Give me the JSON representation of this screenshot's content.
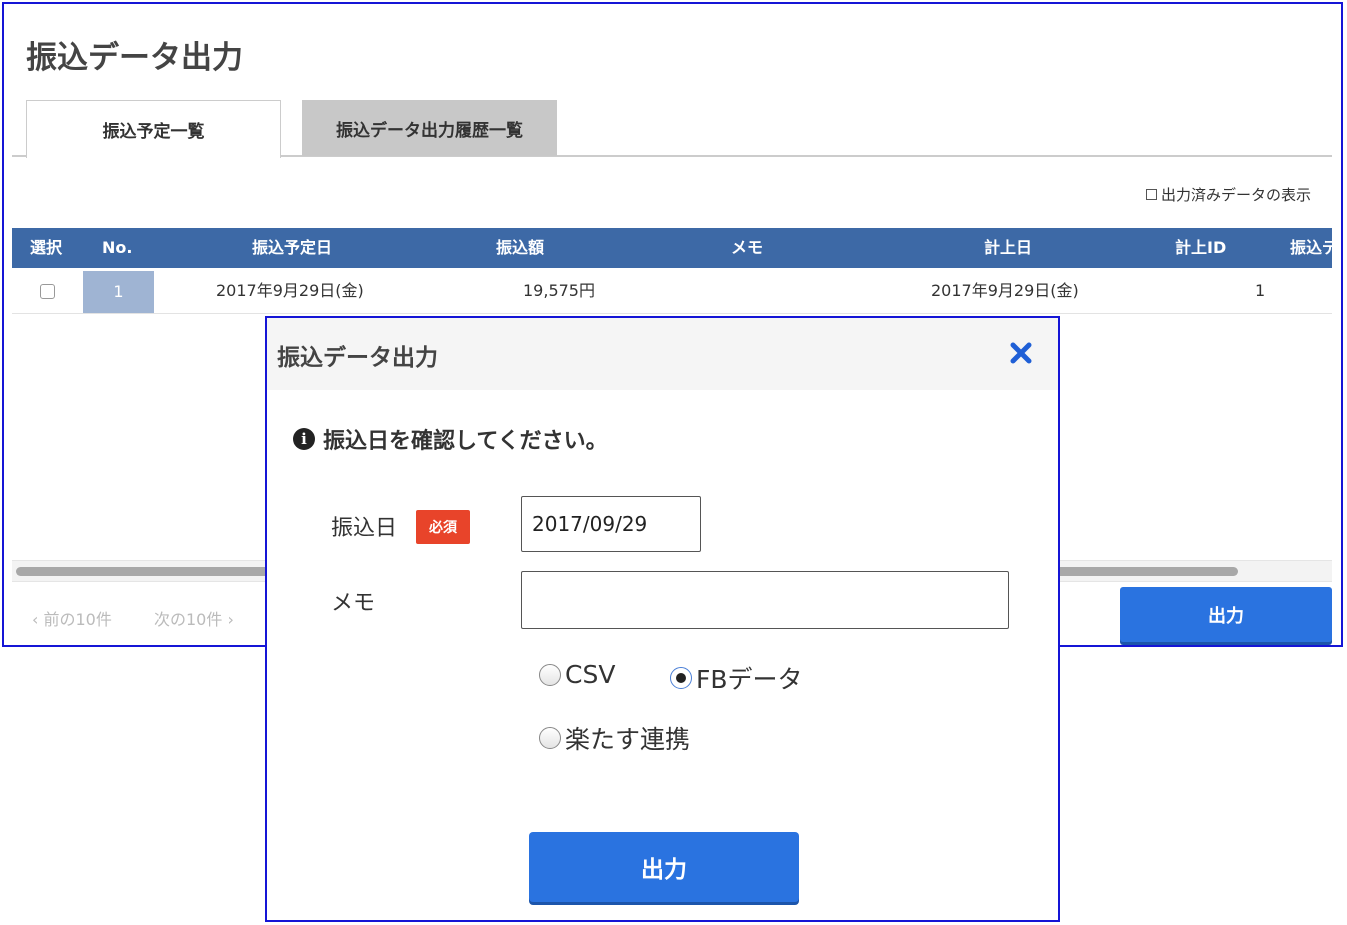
{
  "page": {
    "title": "振込データ出力",
    "tabs": [
      {
        "label": "振込予定一覧",
        "active": true
      },
      {
        "label": "振込データ出力履歴一覧",
        "active": false
      }
    ],
    "show_output_label": "出力済みデータの表示",
    "table": {
      "headers": [
        "選択",
        "No.",
        "振込予定日",
        "振込額",
        "メモ",
        "計上日",
        "計上ID",
        "振込デ"
      ],
      "rows": [
        {
          "no": "1",
          "scheduled_date": "2017年9月29日(金)",
          "amount": "19,575円",
          "memo": "",
          "booked_date": "2017年9月29日(金)",
          "booked_id": "1"
        }
      ]
    },
    "pager": {
      "prev": "前の10件",
      "next": "次の10件"
    },
    "output_button": "出力"
  },
  "modal": {
    "title": "振込データ出力",
    "notice": "振込日を確認してください。",
    "date_label": "振込日",
    "required_badge": "必須",
    "date_value": "2017/09/29",
    "memo_label": "メモ",
    "memo_value": "",
    "formats": [
      {
        "label": "CSV",
        "checked": false
      },
      {
        "label": "FBデータ",
        "checked": true
      },
      {
        "label": "楽たす連携",
        "checked": false
      }
    ],
    "output_button": "出力"
  },
  "colors": {
    "header_blue": "#3d69a6",
    "button_blue": "#2a73e0",
    "required_red": "#e8442a",
    "close_blue": "#1f5fd6",
    "frame_blue": "#1515d6"
  }
}
